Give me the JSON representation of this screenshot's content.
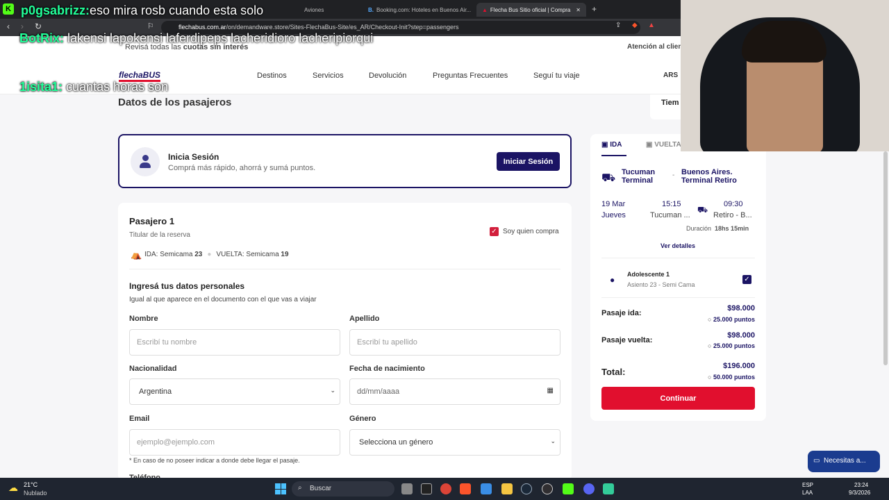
{
  "browser": {
    "tabs": [
      {
        "label": "Aviones"
      },
      {
        "label": "Booking.com: Hoteles en Buenos Air..."
      },
      {
        "label": "Flecha Bus Sitio oficial | Compra"
      }
    ],
    "url_domain": "flechabus.com.ar",
    "url_path": "/on/demandware.store/Sites-FlechaBus-Site/es_AR/Checkout-Init?step=passengers"
  },
  "overlay_chat": [
    {
      "user": "p0gsabrizz:",
      "msg": "eso mira rosb cuando esta solo"
    },
    {
      "user": "BotRix:",
      "msg": "lakensi lapokensi laferdipeps lacheridioro lacheripiorqui"
    },
    {
      "user": "1isita1:",
      "msg": "cuantas horas son"
    }
  ],
  "promo": {
    "text": "Revisá todas las",
    "highlight": "cuotas sin interés",
    "right": "Atención al clien"
  },
  "site": {
    "logo": "flechaBUS",
    "nav": [
      "Destinos",
      "Servicios",
      "Devolución",
      "Preguntas Frecuentes",
      "Seguí tu viaje"
    ],
    "currency": "ARS",
    "timer_label": "Tiem"
  },
  "page_title": "Datos de los pasajeros",
  "login": {
    "title": "Inicia Sesión",
    "subtitle": "Comprá más rápido, ahorrá y sumá puntos.",
    "button": "Iniciar Sesión"
  },
  "passenger": {
    "title": "Pasajero 1",
    "subtitle": "Titular de la reserva",
    "buyer_label": "Soy quien compra",
    "seat_ida_label": "IDA: Semicama",
    "seat_ida_num": "23",
    "seat_vuelta_label": "VUELTA: Semicama",
    "seat_vuelta_num": "19",
    "section_title": "Ingresá tus datos personales",
    "section_sub": "Igual al que aparece en el documento con el que vas a viajar",
    "nombre_label": "Nombre",
    "nombre_ph": "Escribí tu nombre",
    "apellido_label": "Apellido",
    "apellido_ph": "Escribí tu apellido",
    "nac_label": "Nacionalidad",
    "nac_value": "Argentina",
    "fecha_label": "Fecha de nacimiento",
    "fecha_ph": "dd/mm/aaaa",
    "email_label": "Email",
    "email_ph": "ejemplo@ejemplo.com",
    "genero_label": "Género",
    "genero_value": "Selecciona un género",
    "email_note": "* En caso de no poseer indicar a donde debe llegar el pasaje.",
    "tel_label": "Teléfono"
  },
  "summary": {
    "tab_ida": "IDA",
    "tab_vuelta": "VUELTA",
    "origin": "Tucuman Terminal",
    "dest": "Buenos Aires. Terminal Retiro",
    "date": "19 Mar",
    "weekday": "Jueves",
    "dep_time": "15:15",
    "dep_place": "Tucuman ...",
    "arr_time": "09:30",
    "arr_place": "Retiro - B...",
    "duration_label": "Duración",
    "duration": "18hs 15min",
    "details": "Ver detalles",
    "pax_title": "Adolescente 1",
    "pax_sub": "Asiento 23 - Semi Cama",
    "ida_label": "Pasaje ida:",
    "ida_price": "$98.000",
    "ida_points": "25.000 puntos",
    "vuelta_label": "Pasaje vuelta:",
    "vuelta_price": "$98.000",
    "vuelta_points": "25.000 puntos",
    "total_label": "Total:",
    "total_price": "$196.000",
    "total_points": "50.000 puntos",
    "continue": "Continuar"
  },
  "help": "Necesitas a...",
  "taskbar": {
    "temp": "21°C",
    "weather": "Nublado",
    "search": "Buscar",
    "lang": "ESP",
    "lang2": "LAA",
    "time": "23:24",
    "date": "9/3/2026"
  },
  "colors": {
    "brand": "#1b1464",
    "accent": "#e10f2e"
  }
}
